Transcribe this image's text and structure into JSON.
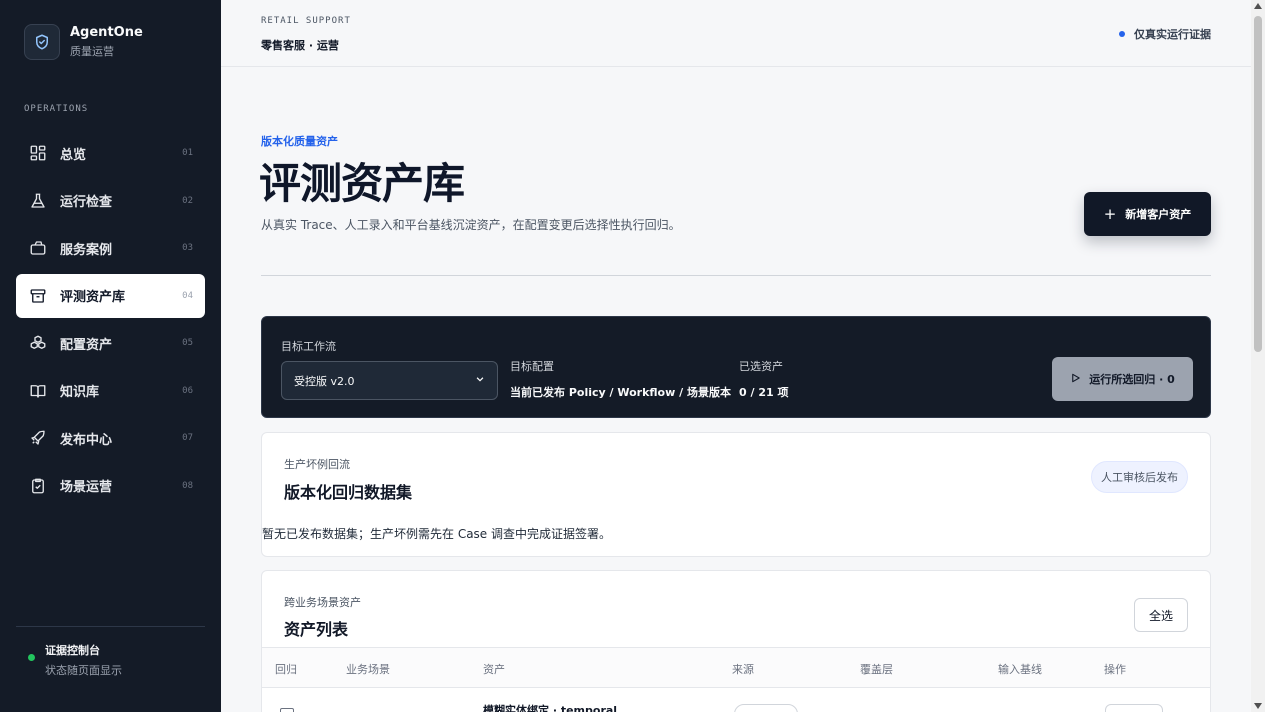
{
  "brand": {
    "name": "AgentOne",
    "subtitle": "质量运营"
  },
  "sidebar": {
    "heading": "OPERATIONS",
    "items": [
      {
        "label": "总览",
        "num": "01",
        "icon": "dashboard-icon"
      },
      {
        "label": "运行检查",
        "num": "02",
        "icon": "flask-icon"
      },
      {
        "label": "服务案例",
        "num": "03",
        "icon": "briefcase-icon"
      },
      {
        "label": "评测资产库",
        "num": "04",
        "icon": "archive-icon",
        "active": true
      },
      {
        "label": "配置资产",
        "num": "05",
        "icon": "boxes-icon"
      },
      {
        "label": "知识库",
        "num": "06",
        "icon": "book-icon"
      },
      {
        "label": "发布中心",
        "num": "07",
        "icon": "rocket-icon"
      },
      {
        "label": "场景运营",
        "num": "08",
        "icon": "clipboard-check-icon"
      }
    ],
    "status": {
      "title": "证据控制台",
      "subtitle": "状态随页面显示",
      "color": "#22c55e"
    }
  },
  "header": {
    "kicker": "RETAIL SUPPORT",
    "title": "零售客服 · 运营",
    "mode_label": "仅真实运行证据"
  },
  "hero": {
    "eyebrow": "版本化质量资产",
    "title": "评测资产库",
    "description": "从真实 Trace、人工录入和平台基线沉淀资产，在配置变更后选择性执行回归。",
    "new_button": "新增客户资产"
  },
  "control": {
    "workflow_label": "目标工作流",
    "workflow_value": "受控版 v2.0",
    "config_label": "目标配置",
    "config_value": "当前已发布 Policy / Workflow / 场景版本",
    "selected_label": "已选资产",
    "selected_value": "0 / 21 项",
    "run_button": "运行所选回归 · 0"
  },
  "dataset": {
    "subtitle": "生产坏例回流",
    "title": "版本化回归数据集",
    "badge": "人工审核后发布",
    "empty": "暂无已发布数据集；生产坏例需先在 Case 调查中完成证据签署。"
  },
  "assets": {
    "subtitle": "跨业务场景资产",
    "title": "资产列表",
    "select_all": "全选",
    "columns": [
      "回归",
      "业务场景",
      "资产",
      "来源",
      "覆盖层",
      "输入基线",
      "操作"
    ],
    "first_row_asset": "模糊实体绑定 · temporal"
  },
  "colors": {
    "accent": "#2563eb",
    "sidebar_bg": "#141b27",
    "status_green": "#22c55e"
  }
}
